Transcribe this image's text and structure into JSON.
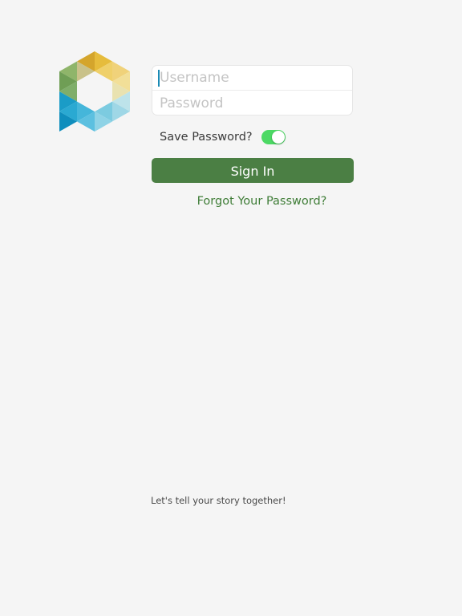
{
  "login": {
    "username_placeholder": "Username",
    "password_placeholder": "Password",
    "username_value": "",
    "password_value": ""
  },
  "save_password": {
    "label": "Save Password?",
    "enabled": true
  },
  "sign_in_label": "Sign In",
  "forgot_password_label": "Forgot Your Password?",
  "tagline": "Let's tell your story together!",
  "colors": {
    "background": "#f5f5f5",
    "sign_in_button": "#4b7f44",
    "link": "#3f7d37",
    "toggle_on": "#4cd964"
  },
  "icons": {
    "logo": "app-logo-icon"
  }
}
